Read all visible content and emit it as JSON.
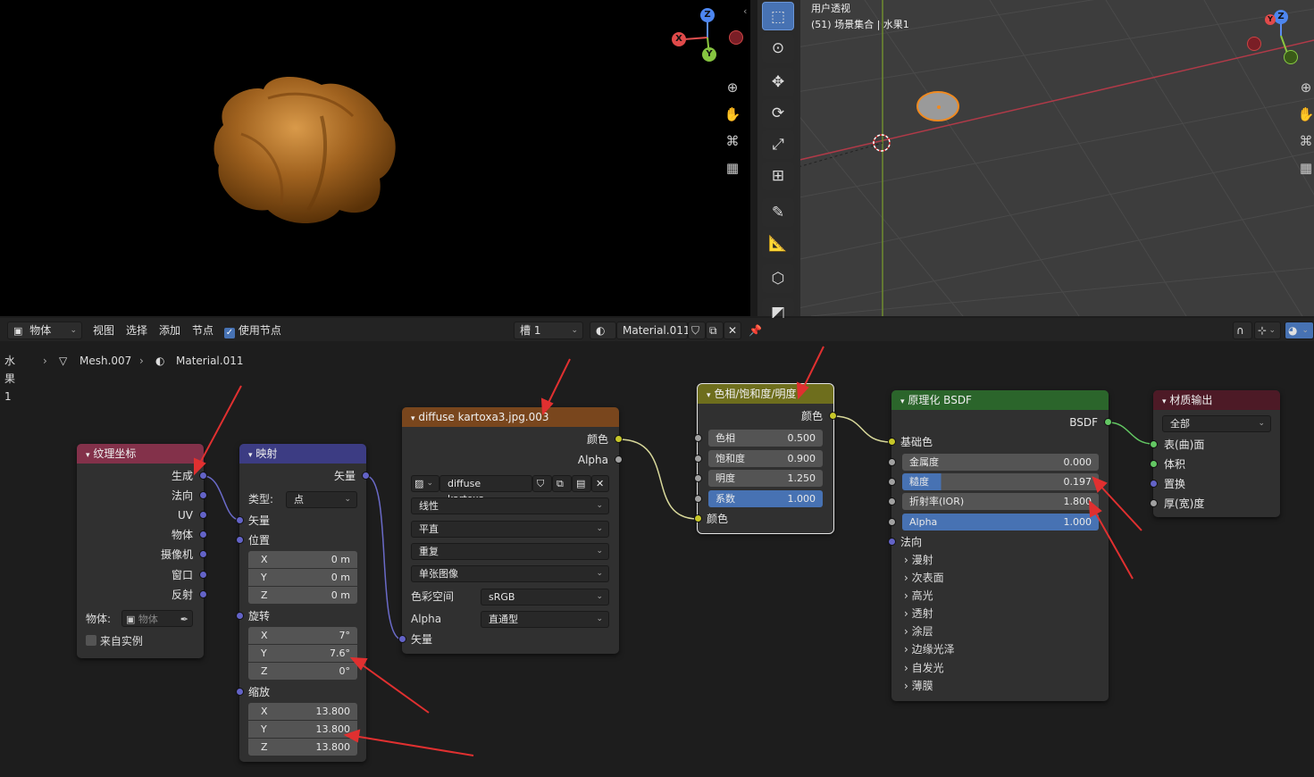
{
  "viewport": {
    "title": "用户透视",
    "subtitle": "(51) 场景集合 | 水果1",
    "gizmo": {
      "x": "X",
      "y": "Y",
      "z": "Z"
    }
  },
  "header": {
    "mode": "物体",
    "menus": [
      "视图",
      "选择",
      "添加",
      "节点"
    ],
    "use_nodes": "使用节点",
    "slot": "槽 1",
    "material": "Material.011"
  },
  "breadcrumb": {
    "object": "水果1",
    "mesh": "Mesh.007",
    "material": "Material.011"
  },
  "texcoord": {
    "title": "纹理坐标",
    "outputs": [
      "生成",
      "法向",
      "UV",
      "物体",
      "摄像机",
      "窗口",
      "反射"
    ],
    "object_label": "物体:",
    "object_placeholder": "物体",
    "from_instancer": "来自实例"
  },
  "mapping": {
    "title": "映射",
    "output": "矢量",
    "type_label": "类型:",
    "type_value": "点",
    "vector": "矢量",
    "location": "位置",
    "loc": [
      {
        "k": "X",
        "v": "0 m"
      },
      {
        "k": "Y",
        "v": "0 m"
      },
      {
        "k": "Z",
        "v": "0 m"
      }
    ],
    "rotation": "旋转",
    "rot": [
      {
        "k": "X",
        "v": "7°"
      },
      {
        "k": "Y",
        "v": "7.6°"
      },
      {
        "k": "Z",
        "v": "0°"
      }
    ],
    "scale": "缩放",
    "scl": [
      {
        "k": "X",
        "v": "13.800"
      },
      {
        "k": "Y",
        "v": "13.800"
      },
      {
        "k": "Z",
        "v": "13.800"
      }
    ]
  },
  "image": {
    "title": "diffuse kartoxa3.jpg.003",
    "out_color": "颜色",
    "out_alpha": "Alpha",
    "image_name": "diffuse kartoxa...",
    "interpolation": "线性",
    "projection": "平直",
    "extension": "重复",
    "source": "单张图像",
    "colorspace_label": "色彩空间",
    "colorspace": "sRGB",
    "alpha_label": "Alpha",
    "alpha_mode": "直通型",
    "in_vector": "矢量"
  },
  "hsv": {
    "title": "色相/饱和度/明度",
    "out_color": "颜色",
    "fields": [
      {
        "k": "色相",
        "v": "0.500"
      },
      {
        "k": "饱和度",
        "v": "0.900"
      },
      {
        "k": "明度",
        "v": "1.250"
      },
      {
        "k": "系数",
        "v": "1.000"
      }
    ],
    "in_color": "颜色"
  },
  "bsdf": {
    "title": "原理化 BSDF",
    "out": "BSDF",
    "base_color": "基础色",
    "fields": [
      {
        "k": "金属度",
        "v": "0.000"
      },
      {
        "k": "糙度",
        "v": "0.197"
      },
      {
        "k": "折射率(IOR)",
        "v": "1.800"
      },
      {
        "k": "Alpha",
        "v": "1.000"
      }
    ],
    "normal": "法向",
    "panels": [
      "漫射",
      "次表面",
      "高光",
      "透射",
      "涂层",
      "边缘光泽",
      "自发光",
      "薄膜"
    ]
  },
  "output": {
    "title": "材质输出",
    "target": "全部",
    "inputs": [
      "表(曲)面",
      "体积",
      "置换",
      "厚(宽)度"
    ]
  },
  "colors": {
    "texcoord_header": "#83314a",
    "vector_header": "#3c3c83",
    "texture_header": "#79461d",
    "color_header": "#6e6e1d",
    "shader_header": "#2b652b",
    "output_header": "#4d1a26",
    "field_blue": "#4772b3",
    "arrow": "#e03030"
  }
}
